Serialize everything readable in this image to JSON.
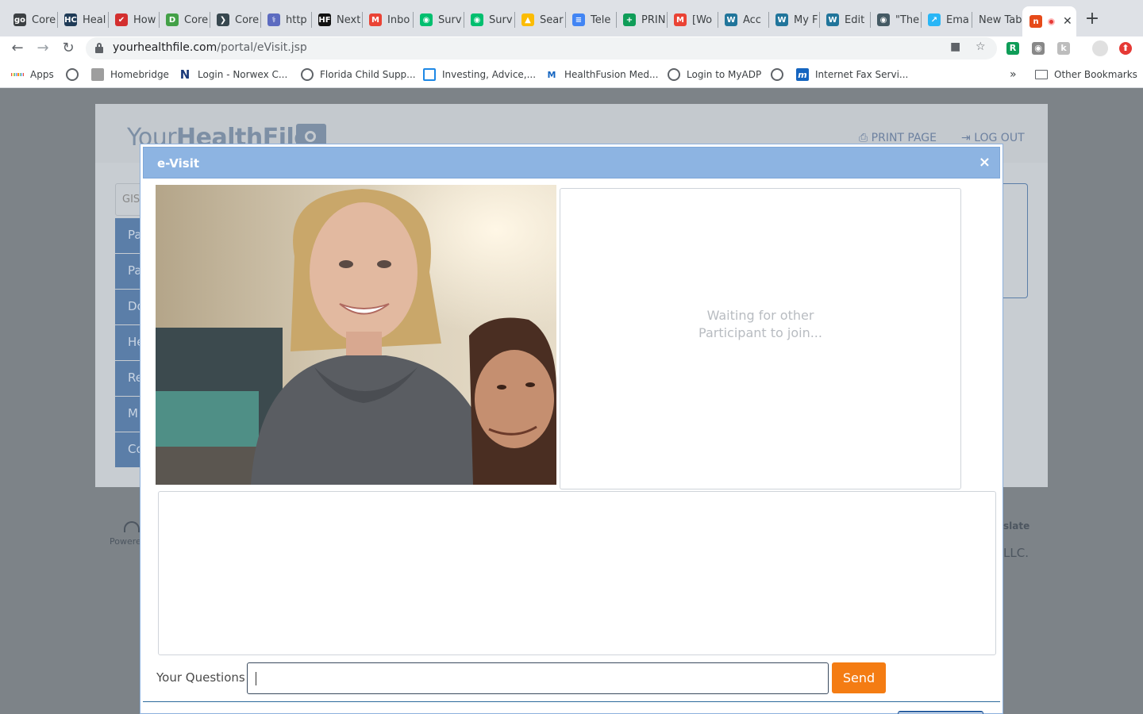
{
  "browser": {
    "tabs": [
      {
        "label": "Core",
        "fav_text": "go",
        "fav_bg": "#3c4043"
      },
      {
        "label": "Heal",
        "fav_text": "HC",
        "fav_bg": "#1f3b57"
      },
      {
        "label": "How",
        "fav_text": "✔",
        "fav_bg": "#d32f2f"
      },
      {
        "label": "Core",
        "fav_text": "D",
        "fav_bg": "#43a047"
      },
      {
        "label": "Core",
        "fav_text": "❯",
        "fav_bg": "#37474f"
      },
      {
        "label": "http",
        "fav_text": "⚕",
        "fav_bg": "#5c6bc0"
      },
      {
        "label": "Next",
        "fav_text": "HF",
        "fav_bg": "#111111"
      },
      {
        "label": "Inbo",
        "fav_text": "M",
        "fav_bg": "#ea4335"
      },
      {
        "label": "Surv",
        "fav_text": "◉",
        "fav_bg": "#00bf6f"
      },
      {
        "label": "Surv",
        "fav_text": "◉",
        "fav_bg": "#00bf6f"
      },
      {
        "label": "Sear",
        "fav_text": "▲",
        "fav_bg": "#fbbc04"
      },
      {
        "label": "Tele",
        "fav_text": "≡",
        "fav_bg": "#4285f4"
      },
      {
        "label": "PRIN",
        "fav_text": "+",
        "fav_bg": "#0f9d58"
      },
      {
        "label": "[Wo",
        "fav_text": "M",
        "fav_bg": "#ea4335"
      },
      {
        "label": "Acc",
        "fav_text": "W",
        "fav_bg": "#21759b"
      },
      {
        "label": "My F",
        "fav_text": "W",
        "fav_bg": "#21759b"
      },
      {
        "label": "Edit",
        "fav_text": "W",
        "fav_bg": "#21759b"
      },
      {
        "label": "\"The",
        "fav_text": "◉",
        "fav_bg": "#455a64"
      },
      {
        "label": "Ema",
        "fav_text": "↗",
        "fav_bg": "#29b6f6"
      },
      {
        "label": "New Tab",
        "fav_text": "",
        "fav_bg": ""
      },
      {
        "label": "",
        "fav_text": "n",
        "fav_bg": "#e64a19"
      }
    ],
    "address": {
      "domain": "yourhealthfile.com",
      "path": "/portal/eVisit.jsp"
    },
    "bookmarks": [
      {
        "label": "Apps"
      },
      {
        "label": ""
      },
      {
        "label": "Homebridge"
      },
      {
        "label": "Login - Norwex C..."
      },
      {
        "label": "Florida Child Supp..."
      },
      {
        "label": "Investing, Advice,..."
      },
      {
        "label": "HealthFusion Med..."
      },
      {
        "label": "Login to MyADP"
      },
      {
        "label": ""
      },
      {
        "label": "Internet Fax Servi..."
      }
    ],
    "bookmarks_overflow": "»",
    "other_bookmarks": "Other Bookmarks",
    "extensions": [
      {
        "text": "R",
        "bg": "#0f9d58"
      },
      {
        "text": "◉",
        "bg": "#888888"
      },
      {
        "text": "k",
        "bg": "#bdbdbd"
      },
      {
        "text": "",
        "bg": "#e0e0e0"
      },
      {
        "text": "⬆",
        "bg": "#e53935"
      }
    ]
  },
  "page": {
    "logo_prefix": "Your",
    "logo_bold": "HealthFile",
    "logo_suffix": "®",
    "print_label": "PRINT PAGE",
    "logout_label": "LOG OUT",
    "search_hint": "GIS",
    "nav_items": [
      "Pa",
      "Pa",
      "Do",
      "He",
      "Re",
      "M",
      "Co"
    ],
    "powered": "Powere",
    "translate": "slate",
    "copyright_tail": "LLC."
  },
  "modal": {
    "title": "e-Visit",
    "close": "×",
    "waiting_line1": "Waiting for other",
    "waiting_line2": "Participant to join...",
    "questions_label": "Your Questions",
    "questions_value": "",
    "send_label": "Send"
  }
}
